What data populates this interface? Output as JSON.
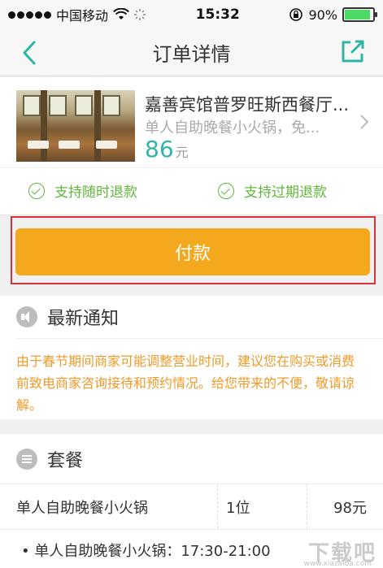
{
  "status_bar": {
    "carrier": "中国移动",
    "time": "15:32",
    "battery": "90%",
    "battery_level": 0.9
  },
  "nav": {
    "title": "订单详情"
  },
  "deal": {
    "name": "嘉善宾馆普罗旺斯西餐厅...",
    "description": "单人自助晚餐小火锅，免...",
    "price": "86",
    "price_unit": "元",
    "refund_anytime": "支持随时退款",
    "refund_expired": "支持过期退款"
  },
  "pay": {
    "label": "付款",
    "color": "#f3a81e"
  },
  "notice": {
    "title": "最新通知",
    "text": "由于春节期间商家可能调整营业时间，建议您在购买或消费前致电商家咨询接待和预约情况。给您带来的不便，敬请谅解。"
  },
  "combo": {
    "title": "套餐",
    "row": {
      "name": "单人自助晚餐小火锅",
      "qty": "1位",
      "price": "98元"
    },
    "detail": "• 单人自助晚餐小火锅：17:30-21:00"
  },
  "watermark": {
    "text": "下载吧",
    "url": "www.xiazaiba.com"
  },
  "colors": {
    "accent": "#2fb5a6",
    "notice": "#f09a28",
    "check": "#5fb83a",
    "highlight": "#d5343b"
  }
}
